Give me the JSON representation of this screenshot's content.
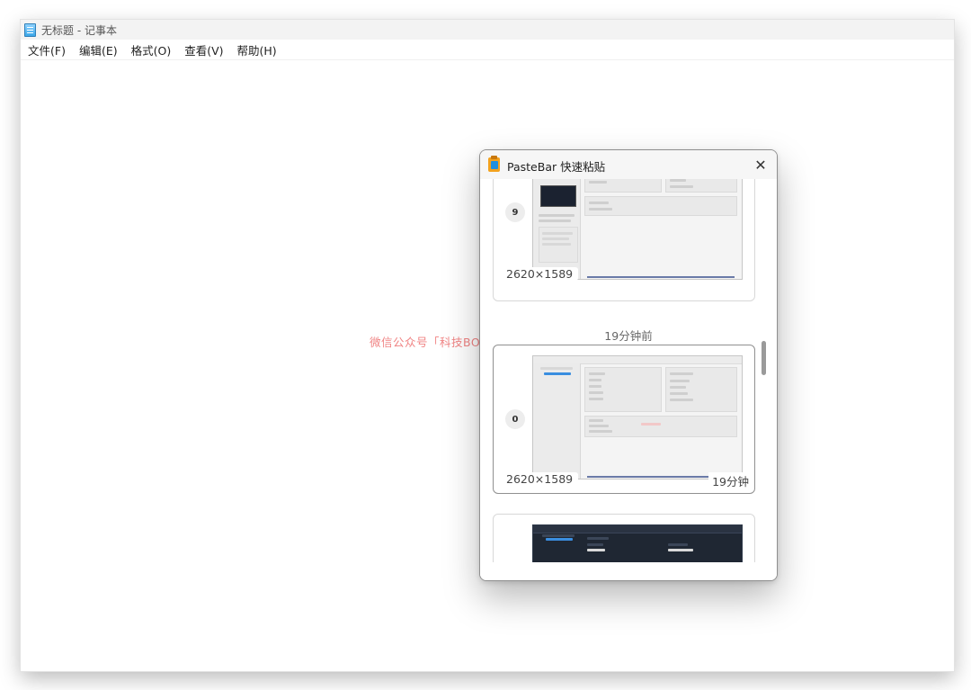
{
  "notepad": {
    "title": "无标题 - 记事本",
    "menu": [
      "文件(F)",
      "编辑(E)",
      "格式(O)",
      "查看(V)",
      "帮助(H)"
    ]
  },
  "watermark": "微信公众号「科技BOOM」",
  "pastebar": {
    "title": "PasteBar 快速粘贴",
    "close_label": "✕",
    "cards": [
      {
        "index": "9",
        "size": "2620×1589",
        "time": ""
      },
      {
        "group_time": "19分钟前",
        "index": "0",
        "size": "2620×1589",
        "time": "19分钟"
      },
      {
        "index": "",
        "size": "",
        "time": ""
      }
    ]
  }
}
